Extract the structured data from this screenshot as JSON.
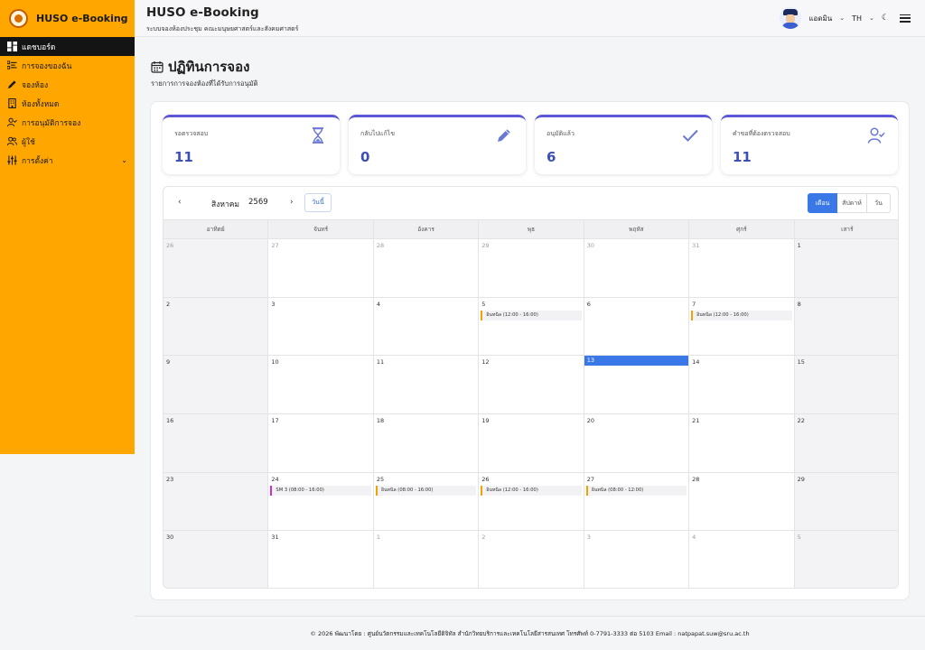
{
  "sidebar": {
    "brand": "HUSO e-Booking",
    "items": [
      {
        "label": "แดชบอร์ด",
        "icon": "dashboard-icon"
      },
      {
        "label": "การจองของฉัน",
        "icon": "list-icon"
      },
      {
        "label": "จองห้อง",
        "icon": "pencil-icon"
      },
      {
        "label": "ห้องทั้งหมด",
        "icon": "building-icon"
      },
      {
        "label": "การอนุมัติการจอง",
        "icon": "user-check-icon"
      },
      {
        "label": "ผู้ใช้",
        "icon": "users-icon"
      },
      {
        "label": "การตั้งค่า",
        "icon": "sliders-icon"
      }
    ]
  },
  "topbar": {
    "title": "HUSO e-Booking",
    "subtitle": "ระบบจองห้องประชุม คณะมนุษยศาสตร์และสังคมศาสตร์",
    "user": "แอดมิน",
    "lang": "TH"
  },
  "page": {
    "title": "ปฏิทินการจอง",
    "subtitle": "รายการการจองห้องที่ได้รับการอนุมัติ"
  },
  "stats": [
    {
      "label": "รอตรวจสอบ",
      "value": "11",
      "icon": "hourglass-icon"
    },
    {
      "label": "กลับไปแก้ไข",
      "value": "0",
      "icon": "pencil-icon"
    },
    {
      "label": "อนุมัติแล้ว",
      "value": "6",
      "icon": "check-icon"
    },
    {
      "label": "คำขอที่ต้องตรวจสอบ",
      "value": "11",
      "icon": "user-check-icon"
    }
  ],
  "calendar": {
    "month": "สิงหาคม",
    "year": "2569",
    "today_label": "วันนี้",
    "views": [
      "เดือน",
      "สัปดาห์",
      "วัน"
    ],
    "active_view": "เดือน",
    "weekdays": [
      "อาทิตย์",
      "จันทร์",
      "อังคาร",
      "พุธ",
      "พฤหัส",
      "ศุกร์",
      "เสาร์"
    ],
    "days": [
      {
        "n": "26",
        "other": true
      },
      {
        "n": "27",
        "other": true
      },
      {
        "n": "28",
        "other": true
      },
      {
        "n": "29",
        "other": true
      },
      {
        "n": "30",
        "other": true
      },
      {
        "n": "31",
        "other": true
      },
      {
        "n": "1"
      },
      {
        "n": "2"
      },
      {
        "n": "3"
      },
      {
        "n": "4"
      },
      {
        "n": "5",
        "event": "อินทนิล (12:00 - 16:00)"
      },
      {
        "n": "6"
      },
      {
        "n": "7",
        "event": "อินทนิล (12:00 - 16:00)"
      },
      {
        "n": "8"
      },
      {
        "n": "9"
      },
      {
        "n": "10"
      },
      {
        "n": "11"
      },
      {
        "n": "12"
      },
      {
        "n": "13",
        "today": true
      },
      {
        "n": "14"
      },
      {
        "n": "15"
      },
      {
        "n": "16"
      },
      {
        "n": "17"
      },
      {
        "n": "18"
      },
      {
        "n": "19"
      },
      {
        "n": "20"
      },
      {
        "n": "21"
      },
      {
        "n": "22"
      },
      {
        "n": "23"
      },
      {
        "n": "24",
        "event": "SM 3 (08:00 - 16:00)",
        "event_color": "magenta"
      },
      {
        "n": "25",
        "event": "อินทนิล (08:00 - 16:00)"
      },
      {
        "n": "26",
        "event": "อินทนิล (12:00 - 16:00)"
      },
      {
        "n": "27",
        "event": "อินทนิล (08:00 - 12:00)"
      },
      {
        "n": "28"
      },
      {
        "n": "29"
      },
      {
        "n": "30"
      },
      {
        "n": "31"
      },
      {
        "n": "1",
        "other": true
      },
      {
        "n": "2",
        "other": true
      },
      {
        "n": "3",
        "other": true
      },
      {
        "n": "4",
        "other": true
      },
      {
        "n": "5",
        "other": true
      }
    ]
  },
  "colors": {
    "sidebar": "#ffa600",
    "accent": "#3b78e7",
    "stat_border": "#5b57d8",
    "event_orange": "#f3a300",
    "event_magenta": "#d42ad4"
  },
  "footer": "© 2026 พัฒนาโดย : ศูนย์นวัตกรรมและเทคโนโลยีดิจิทัล สำนักวิทยบริการและเทคโนโลยีสารสนเทศ โทรศัพท์ 0-7791-3333 ต่อ 5103 Email : natpapat.suw@sru.ac.th"
}
